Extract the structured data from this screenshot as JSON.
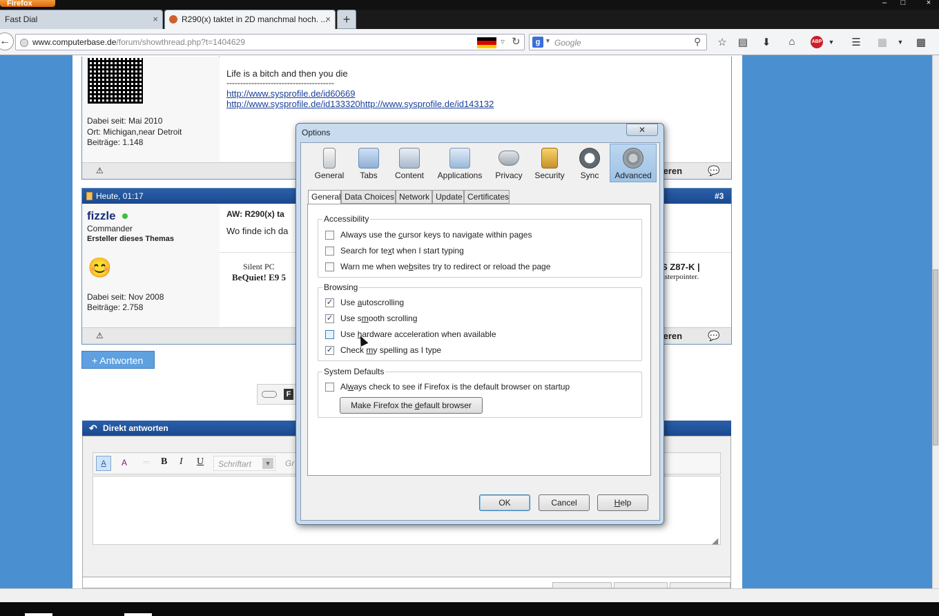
{
  "browser": {
    "menu_label": "Firefox",
    "tabs": [
      {
        "label": "Fast Dial",
        "close": "×"
      },
      {
        "label": "R290(x) taktet in 2D manchmal hoch. ...",
        "close": "×"
      }
    ],
    "new_tab": "+",
    "url_domain": "www.computerbase.de",
    "url_path": "/forum/showthread.php?t=1404629",
    "search_placeholder": "Google",
    "window_controls": [
      "–",
      "□",
      "×"
    ]
  },
  "forum": {
    "post1": {
      "signature_line1": "Life is a bitch and then you die",
      "signature_dashes": "---------------------------------------",
      "link1": "http://www.sysprofile.de/id60669",
      "link2": "http://www.sysprofile.de/id133320http://www.sysprofile.de/id143132",
      "member_since": "Dabei seit: Mai 2010",
      "location": "Ort: Michigan,near Detroit",
      "posts": "Beiträge: 1.148",
      "footer_right": "ieren"
    },
    "post2": {
      "date": "Heute, 01:17",
      "number": "#3",
      "username": "fizzle",
      "rank": "Commander",
      "role": "Ersteller dieses Themas",
      "title": "AW: R290(x) ta",
      "body": "Wo finde ich da",
      "sig_left1": "Silent PC",
      "sig_left2": "BeQuiet! E9 5",
      "sig_right1": "S Z87-K |",
      "sig_right2": "asterpointer.",
      "member_since": "Dabei seit: Nov 2008",
      "posts": "Beiträge: 2.758",
      "footer_right": "ieren"
    },
    "reply_button": "+ Antworten",
    "quick_reply_title": "Direkt antworten",
    "editor": {
      "bold": "B",
      "italic": "I",
      "underline": "U",
      "font_placeholder": "Schriftart",
      "size_placeholder": "Gr"
    }
  },
  "dialog": {
    "title": "Options",
    "close": "✕",
    "panes": [
      {
        "label": "General",
        "icon": "general-icon",
        "color": "#7a8a9a"
      },
      {
        "label": "Tabs",
        "icon": "tabs-icon",
        "color": "#7aa0c8"
      },
      {
        "label": "Content",
        "icon": "content-icon",
        "color": "#8a9bb0"
      },
      {
        "label": "Applications",
        "icon": "applications-icon",
        "color": "#9ab0c8"
      },
      {
        "label": "Privacy",
        "icon": "privacy-icon",
        "color": "#a0a8b0"
      },
      {
        "label": "Security",
        "icon": "security-icon",
        "color": "#c8a030"
      },
      {
        "label": "Sync",
        "icon": "sync-icon",
        "color": "#606870"
      },
      {
        "label": "Advanced",
        "icon": "advanced-icon",
        "color": "#808890"
      }
    ],
    "selected_pane": "Advanced",
    "subtabs": [
      "General",
      "Data Choices",
      "Network",
      "Update",
      "Certificates"
    ],
    "selected_subtab": "General",
    "accessibility": {
      "title": "Accessibility",
      "items": [
        {
          "pre": "Always use the ",
          "u": "c",
          "post": "ursor keys to navigate within pages",
          "checked": false
        },
        {
          "pre": "Search for te",
          "u": "x",
          "post": "t when I start typing",
          "checked": false
        },
        {
          "pre": "Warn me when we",
          "u": "b",
          "post": "sites try to redirect or reload the page",
          "checked": false
        }
      ]
    },
    "browsing": {
      "title": "Browsing",
      "items": [
        {
          "pre": "Use ",
          "u": "a",
          "post": "utoscrolling",
          "checked": true
        },
        {
          "pre": "Use s",
          "u": "m",
          "post": "ooth scrolling",
          "checked": true
        },
        {
          "pre": "Use ",
          "u": "h",
          "post": "ardware acceleration when available",
          "checked": false
        },
        {
          "pre": "Check ",
          "u": "m",
          "post": "y spelling as I type",
          "checked": true
        }
      ]
    },
    "system_defaults": {
      "title": "System Defaults",
      "check": {
        "pre": "Al",
        "u": "w",
        "post": "ays check to see if Firefox is the default browser on startup",
        "checked": false
      },
      "make_default_pre": "Make Firefox the ",
      "make_default_u": "d",
      "make_default_post": "efault browser"
    },
    "ok": "OK",
    "cancel": "Cancel",
    "help_u": "H",
    "help_post": "elp"
  }
}
